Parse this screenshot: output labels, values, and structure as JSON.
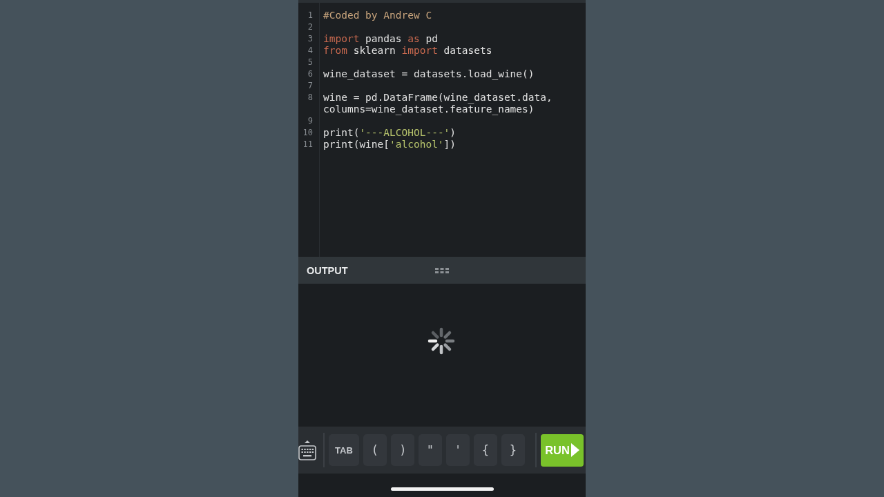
{
  "editor": {
    "lines": [
      {
        "number": "1",
        "tokens": [
          {
            "kind": "comment",
            "text": "#Coded by Andrew C"
          }
        ]
      },
      {
        "number": "2"
      },
      {
        "number": "3",
        "tokens": [
          {
            "kind": "keyword",
            "text": "import"
          },
          {
            "kind": "plain",
            "text": " pandas "
          },
          {
            "kind": "keyword",
            "text": "as"
          },
          {
            "kind": "plain",
            "text": " pd"
          }
        ]
      },
      {
        "number": "4",
        "tokens": [
          {
            "kind": "keyword",
            "text": "from"
          },
          {
            "kind": "plain",
            "text": " sklearn "
          },
          {
            "kind": "keyword",
            "text": "import"
          },
          {
            "kind": "plain",
            "text": " datasets"
          }
        ]
      },
      {
        "number": "5"
      },
      {
        "number": "6",
        "tokens": [
          {
            "kind": "plain",
            "text": "wine_dataset = datasets.load_wine()"
          }
        ]
      },
      {
        "number": "7"
      },
      {
        "number": "8",
        "tokens": [
          {
            "kind": "plain",
            "text": "wine = pd.DataFrame(wine_dataset.data, columns=wine_dataset.feature_names)"
          }
        ]
      },
      {
        "number": "9"
      },
      {
        "number": "10",
        "tokens": [
          {
            "kind": "plain",
            "text": "print("
          },
          {
            "kind": "string",
            "text": "'---ALCOHOL---'"
          },
          {
            "kind": "plain",
            "text": ")"
          }
        ]
      },
      {
        "number": "11",
        "tokens": [
          {
            "kind": "plain",
            "text": "print(wine["
          },
          {
            "kind": "string",
            "text": "'alcohol'"
          },
          {
            "kind": "plain",
            "text": "])"
          }
        ]
      }
    ]
  },
  "output": {
    "title": "OUTPUT",
    "loading": true
  },
  "toolbar": {
    "keys": [
      {
        "label": "TAB"
      },
      {
        "label": "("
      },
      {
        "label": ")"
      },
      {
        "label": "\""
      },
      {
        "label": "'"
      },
      {
        "label": "{"
      },
      {
        "label": "}"
      }
    ],
    "run_button": {
      "label": "RUN"
    }
  }
}
